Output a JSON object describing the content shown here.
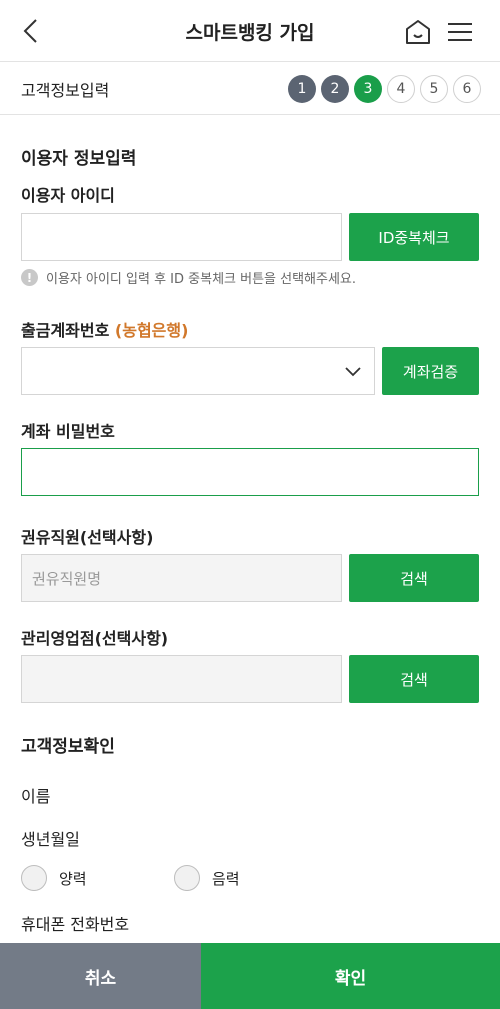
{
  "header": {
    "title": "스마트뱅킹 가입",
    "back_icon": "chevron-left-icon",
    "home_icon": "home-icon",
    "menu_icon": "hamburger-menu-icon"
  },
  "progress": {
    "title": "고객정보입력",
    "steps": [
      "1",
      "2",
      "3",
      "4",
      "5",
      "6"
    ],
    "current_step": 3
  },
  "user_info": {
    "section_title": "이용자 정보입력",
    "user_id_label": "이용자 아이디",
    "user_id_value": "",
    "dup_check_button": "ID중복체크",
    "hint": "이용자 아이디 입력 후 ID 중복체크 버튼을 선택해주세요.",
    "account_label": "출금계좌번호",
    "bank_name": "(농협은행)",
    "account_value": "",
    "verify_button": "계좌검증",
    "password_label": "계좌 비밀번호",
    "password_value": "",
    "staff_label": "권유직원(선택사항)",
    "staff_placeholder": "권유직원명",
    "staff_search_button": "검색",
    "branch_label": "관리영업점(선택사항)",
    "branch_value": "",
    "branch_search_button": "검색"
  },
  "customer_info": {
    "section_title": "고객정보확인",
    "name_label": "이름",
    "birth_label": "생년월일",
    "solar_label": "양력",
    "lunar_label": "음력",
    "phone_label": "휴대폰 전화번호"
  },
  "footer": {
    "cancel_label": "취소",
    "confirm_label": "확인"
  },
  "colors": {
    "accent": "#1ca24b",
    "step_done": "#5b6472",
    "cancel": "#737b87",
    "bank_name": "#d1782b"
  }
}
